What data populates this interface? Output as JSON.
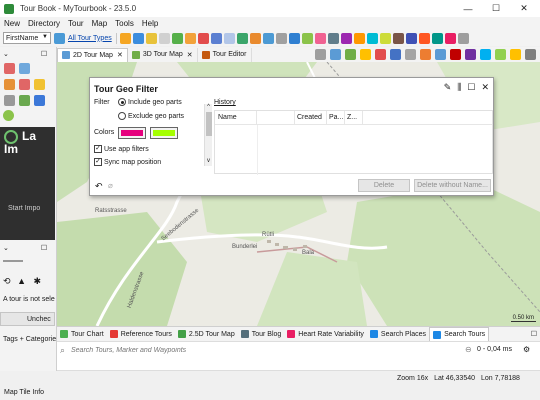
{
  "window": {
    "title": "Tour Book - MyTourbook - 23.5.0",
    "minimize": "—",
    "maximize": "☐",
    "close": "✕"
  },
  "menu": [
    "New",
    "Directory",
    "Tour",
    "Map",
    "Tools",
    "Help"
  ],
  "toolbar": {
    "person_select": "FirstName",
    "tour_types_link": "All Tour Types"
  },
  "map_tabs": [
    {
      "label": "2D Tour Map",
      "close": "✕",
      "active": true
    },
    {
      "label": "3D Tour Map",
      "close": "✕",
      "active": false
    },
    {
      "label": "Tour Editor",
      "close": "",
      "active": false
    }
  ],
  "left_panel": {
    "dark_text_1": "La",
    "dark_text_2": "Im",
    "dark_button": "Start Impo",
    "info_text": "A tour is not sele",
    "uncheck_button": "Unchec",
    "tags_label": "Tags + Categorie"
  },
  "geo_filter": {
    "title": "Tour Geo Filter",
    "filter_label": "Filter",
    "include_option": "Include geo parts",
    "exclude_option": "Exclude geo parts",
    "colors_label": "Colors",
    "color_include": "#e6007e",
    "color_exclude": "#a5ff00",
    "use_app_filters": "Use app filters",
    "sync_map_position": "Sync map position",
    "history_label": "History",
    "columns": [
      "Name",
      "",
      "Created",
      "Pa...",
      "Z..."
    ],
    "delete_button": "Delete",
    "delete_without_name_button": "Delete without Name..."
  },
  "map": {
    "labels": [
      "Ratsstrasse",
      "Seebodenstrasse",
      "Haldenstrasse",
      "Rütli",
      "Bunderlei",
      "Bala"
    ],
    "scale": "0.50 km"
  },
  "bottom_tabs": [
    "Tour Chart",
    "Reference Tours",
    "2.5D Tour Map",
    "Tour Blog",
    "Heart Rate Variability",
    "Search Places",
    "Search Tours"
  ],
  "search": {
    "placeholder": "Search Tours, Marker and Waypoints",
    "results": "0 - 0,04 ms"
  },
  "status": {
    "zoom": "Zoom 16x",
    "lat": "Lat 46,33540",
    "lon": "Lon 7,78188"
  },
  "footer": "Map Tile Info"
}
